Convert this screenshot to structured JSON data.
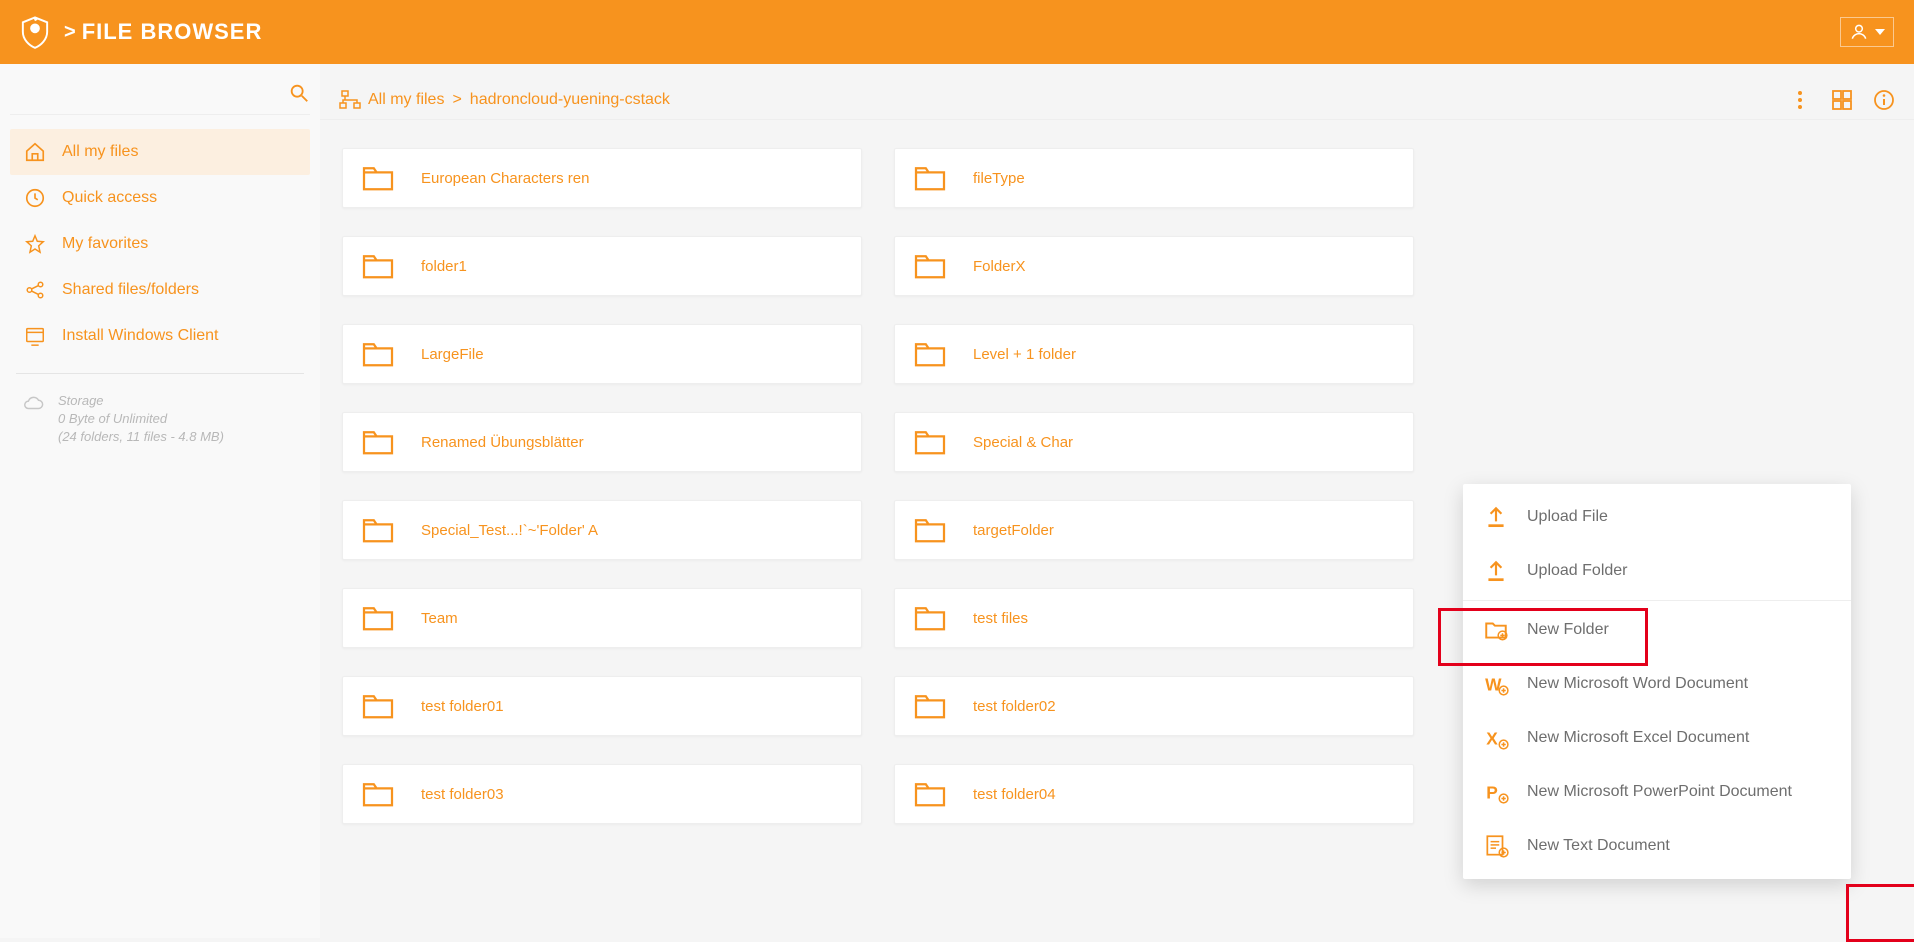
{
  "header": {
    "title": "FILE BROWSER",
    "sep": ">"
  },
  "sidebar": {
    "items": [
      {
        "label": "All my files"
      },
      {
        "label": "Quick access"
      },
      {
        "label": "My favorites"
      },
      {
        "label": "Shared files/folders"
      },
      {
        "label": "Install Windows Client"
      }
    ],
    "storage": {
      "title": "Storage",
      "line1": "0 Byte of Unlimited",
      "line2": "(24 folders, 11 files - 4.8 MB)"
    }
  },
  "breadcrumb": {
    "root": "All my files",
    "sep": ">",
    "current": "hadroncloud-yuening-cstack"
  },
  "folders": [
    "European Characters ren",
    "fileType",
    "folder1",
    "FolderX",
    "LargeFile",
    "Level + 1 folder",
    "Renamed Übungsblätter",
    "Special & Char",
    "Special_Test...!`~'Folder' A",
    "targetFolder",
    "Team",
    "test files",
    "test folder01",
    "test folder02",
    "test folder03",
    "test folder04"
  ],
  "context_menu": [
    "Upload File",
    "Upload Folder",
    "New Folder",
    "New Microsoft Word Document",
    "New Microsoft Excel Document",
    "New Microsoft PowerPoint Document",
    "New Text Document"
  ]
}
